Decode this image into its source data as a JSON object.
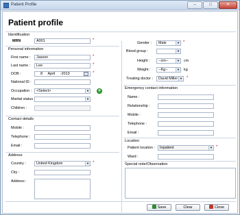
{
  "window": {
    "title": "Patient Profile",
    "minimize": "–",
    "maximize": "□",
    "close": "✕"
  },
  "page_title": "Patient profile",
  "identification": {
    "section_label": "Identification",
    "mrn_label": "MRN",
    "mrn_value": "A001"
  },
  "personal": {
    "section_label": "Personal information",
    "first_name_label": "First name :",
    "first_name_value": "Jasson",
    "last_name_label": "Last name :",
    "last_name_value": "Lee",
    "dob_label": "DOB :",
    "dob_day": "8",
    "dob_month": "April",
    "dob_year": "2013",
    "national_id_label": "National ID :",
    "occupation_label": "Occupation :",
    "occupation_value": "<Select>",
    "marital_label": "Marital status :",
    "children_label": "Children :"
  },
  "contact": {
    "section_label": "Contact details",
    "mobile_label": "Mobile :",
    "telephone_label": "Telephone :",
    "email_label": "Email :"
  },
  "address": {
    "section_label": "Address",
    "country_label": "Country :",
    "country_value": "United Kingdom",
    "city_label": "City :",
    "address_label": "Address :"
  },
  "medical": {
    "gender_label": "Gender :",
    "gender_value": "Male",
    "blood_label": "Blood group :",
    "height_label": "Height :",
    "height_value": "--cm--",
    "height_unit": "cm",
    "weight_label": "Weight :",
    "weight_value": "--Kg--",
    "weight_unit": "kg",
    "doctor_label": "Treating doctor :",
    "doctor_value": "David Miller"
  },
  "emergency": {
    "section_label": "Emergency contact information",
    "name_label": "Name :",
    "relationship_label": "Relationship :",
    "mobile_label": "Mobile :",
    "telephone_label": "Telephone :",
    "email_label": "Email :"
  },
  "location": {
    "section_label": "Location",
    "patient_location_label": "Patient location :",
    "patient_location_value": "Inpatient",
    "ward_label": "Ward :"
  },
  "notes": {
    "section_label": "Special note/Observation"
  },
  "buttons": {
    "save": "Save",
    "clear": "Clear",
    "close": "Close"
  },
  "colors": {
    "required": "#d00000",
    "add_button": "#3aa83a",
    "save_icon": "#2e8b2e",
    "close_icon": "#c0392b"
  }
}
